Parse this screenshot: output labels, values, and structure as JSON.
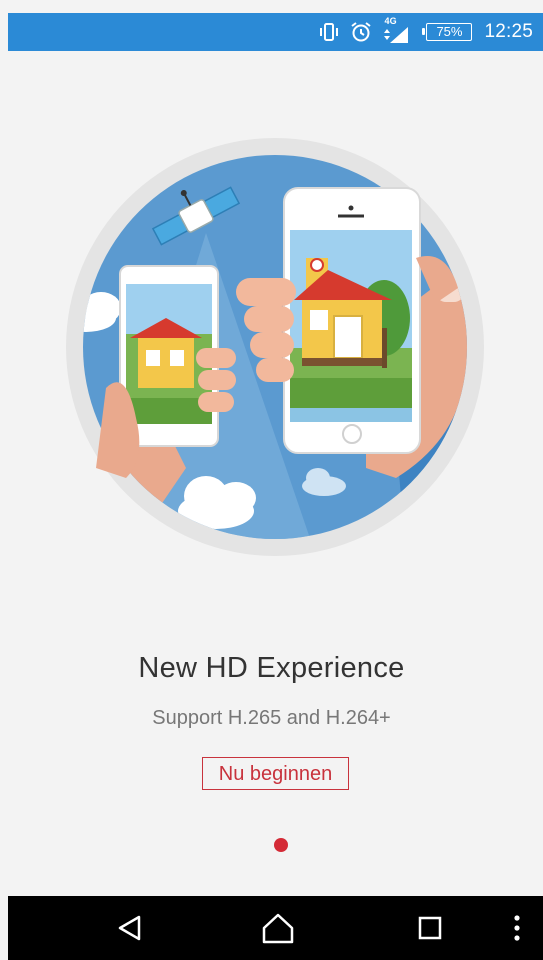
{
  "status_bar": {
    "icons": [
      "vibrate-icon",
      "alarm-icon",
      "signal-icon",
      "battery-icon"
    ],
    "network": "4G",
    "battery": "75%",
    "time": "12:25",
    "background": "#2b8ad6"
  },
  "onboarding": {
    "title": "New HD Experience",
    "subtitle": "Support H.265 and H.264+",
    "start_button": "Nu beginnen",
    "page_indicator": {
      "current": 1,
      "total": 1
    },
    "accent_color": "#c8323c"
  },
  "nav_bar": {
    "buttons": [
      "back-icon",
      "home-icon",
      "recents-icon",
      "overflow-menu-icon"
    ]
  }
}
